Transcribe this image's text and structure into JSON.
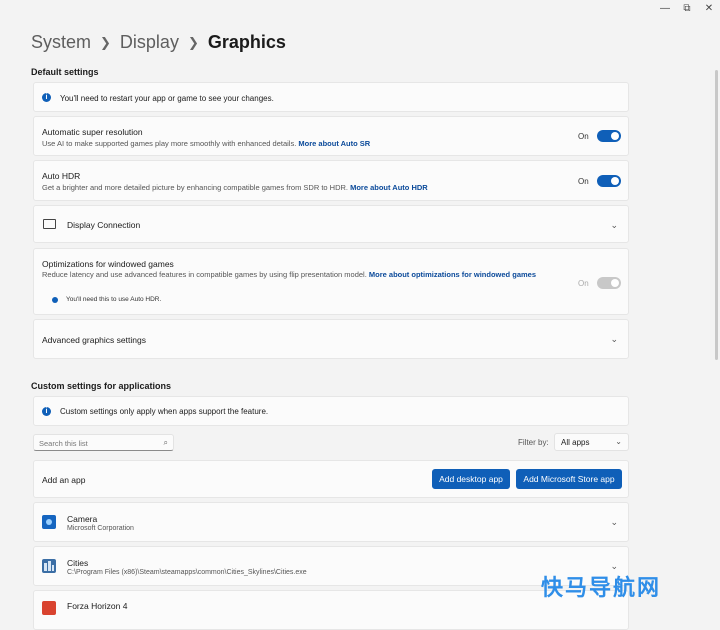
{
  "window": {
    "minimize": "—",
    "restore": "⧉",
    "close": "✕"
  },
  "breadcrumb": {
    "items": [
      "System",
      "Display"
    ],
    "current": "Graphics"
  },
  "default_settings": {
    "title": "Default settings",
    "info": "You'll need to restart your app or game to see your changes.",
    "auto_sr": {
      "title": "Automatic super resolution",
      "desc": "Use AI to make supported games play more smoothly with enhanced details.",
      "link": "More about Auto SR",
      "state": "On"
    },
    "auto_hdr": {
      "title": "Auto HDR",
      "desc": "Get a brighter and more detailed picture by enhancing compatible games from SDR to HDR.",
      "link": "More about Auto HDR",
      "state": "On"
    },
    "display_connection": {
      "title": "Display Connection"
    },
    "windowed_opt": {
      "title": "Optimizations for windowed games",
      "desc": "Reduce latency and use advanced features in compatible games by using flip presentation model.",
      "link_part1": "More about optimizations for windowed",
      "link_part2": "games",
      "state": "On",
      "note": "You'll need this to use Auto HDR."
    },
    "advanced": {
      "title": "Advanced graphics settings"
    }
  },
  "custom_settings": {
    "title": "Custom settings for applications",
    "info": "Custom settings only apply when apps support the feature.",
    "search_placeholder": "Search this list",
    "filter_label": "Filter by:",
    "filter_value": "All apps",
    "add_app_label": "Add an app",
    "add_desktop_button": "Add desktop app",
    "add_store_button": "Add Microsoft Store app",
    "apps": [
      {
        "name": "Camera",
        "sub": "Microsoft Corporation"
      },
      {
        "name": "Cities",
        "sub": "C:\\Program Files (x86)\\Steam\\steamapps\\common\\Cities_Skylines\\Cities.exe"
      },
      {
        "name": "Forza Horizon 4",
        "sub": ""
      }
    ]
  },
  "watermark": "快马导航网",
  "colors": {
    "accent": "#0f5fb8",
    "background": "#f3f3f3",
    "card": "#fbfbfb"
  }
}
